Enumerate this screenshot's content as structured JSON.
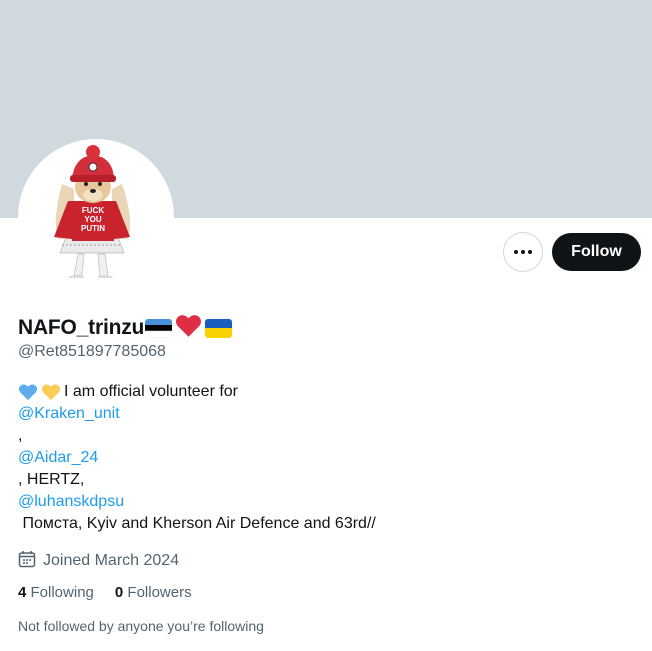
{
  "profile": {
    "display_name": "NAFO_trinzu",
    "name_emojis": [
      "estonia-flag",
      "red-heart",
      "ukraine-flag"
    ],
    "handle": "@Ret851897785068",
    "follow_label": "Follow",
    "more_label": "More",
    "bio": {
      "intro": "I am official volunteer for",
      "mention1": "@Kraken_unit",
      "sep1": ",",
      "mention2": "@Aidar_24",
      "text2": ", HERTZ,",
      "mention3": "@luhanskdpsu",
      "text3": " Помста, Kyiv and Kherson Air Defence and 63rd//"
    },
    "joined": "Joined March 2024",
    "following_count": "4",
    "following_label": "Following",
    "followers_count": "0",
    "followers_label": "Followers",
    "not_followed": "Not followed by anyone you’re following"
  },
  "avatar": {
    "sweater_text_1": "FUCK",
    "sweater_text_2": "YOU",
    "sweater_text_3": "PUTIN"
  },
  "colors": {
    "banner": "#cfd9de",
    "follow_bg": "#0f1419",
    "link": "#1d9bf0",
    "secondary_text": "#536471"
  }
}
